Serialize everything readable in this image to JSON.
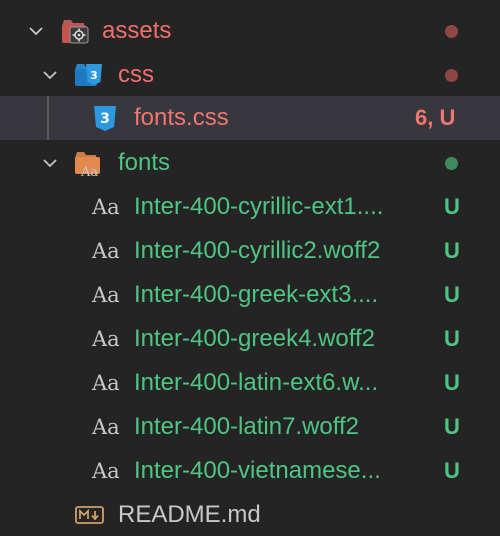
{
  "colors": {
    "background": "#242425",
    "selected_row": "#37373d",
    "error_folder_text": "#f1706c",
    "error_dot": "#8f4745",
    "untracked_text": "#4fc583",
    "untracked_dot": "#3e8a5a",
    "modified_status": "#f0766f",
    "plain_text": "#c8c8c8"
  },
  "tree": {
    "assets": {
      "label": "assets",
      "icon": "assets-folder-icon",
      "expanded": true
    },
    "css": {
      "label": "css",
      "icon": "css-folder-icon",
      "expanded": true
    },
    "fonts_css": {
      "label": "fonts.css",
      "icon": "css3-file-icon",
      "status": "6, U"
    },
    "fonts": {
      "label": "fonts",
      "icon": "fonts-folder-icon",
      "expanded": true
    },
    "font_files": [
      {
        "label": "Inter-400-cyrillic-ext1....",
        "icon_glyph": "Aa",
        "status": "U"
      },
      {
        "label": "Inter-400-cyrillic2.woff2",
        "icon_glyph": "Aa",
        "status": "U"
      },
      {
        "label": "Inter-400-greek-ext3....",
        "icon_glyph": "Aa",
        "status": "U"
      },
      {
        "label": "Inter-400-greek4.woff2",
        "icon_glyph": "Aa",
        "status": "U"
      },
      {
        "label": "Inter-400-latin-ext6.w...",
        "icon_glyph": "Aa",
        "status": "U"
      },
      {
        "label": "Inter-400-latin7.woff2",
        "icon_glyph": "Aa",
        "status": "U"
      },
      {
        "label": "Inter-400-vietnamese...",
        "icon_glyph": "Aa",
        "status": "U"
      }
    ],
    "readme": {
      "label": "README.md",
      "icon": "markdown-file-icon"
    }
  }
}
